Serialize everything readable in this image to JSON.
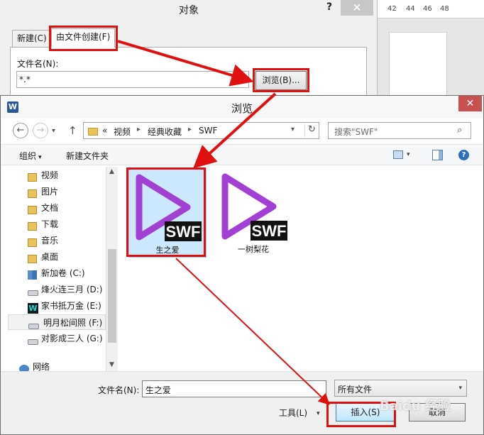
{
  "ruler": {
    "ticks": [
      "42",
      "44",
      "46",
      "48"
    ]
  },
  "object_dialog": {
    "title": "对象",
    "help": "?",
    "close": "✕",
    "tabs": [
      {
        "label": "新建(C)"
      },
      {
        "label": "由文件创建(F)"
      }
    ],
    "file_name_label": "文件名(N):",
    "file_name_value": "*.*",
    "browse_button": "浏览(B)..."
  },
  "browse_dialog": {
    "app_icon": "W",
    "title": "浏览",
    "close": "✕",
    "nav": {
      "back": "←",
      "forward": "→",
      "up": "↑",
      "dropdown": "▾"
    },
    "address": {
      "overflow": "«",
      "path": [
        "视频",
        "经典收藏",
        "SWF"
      ],
      "separator": "▸",
      "dropdown": "▾",
      "refresh": "↻"
    },
    "search": {
      "placeholder": "搜索\"SWF\"",
      "icon": "⌕"
    },
    "toolbar": {
      "organize": "组织",
      "organize_caret": "▾",
      "new_folder": "新建文件夹",
      "view_caret": "▾",
      "help": "?"
    },
    "nav_pane": {
      "items": [
        {
          "label": "视频",
          "icon": "library-icon"
        },
        {
          "label": "图片",
          "icon": "library-icon"
        },
        {
          "label": "文档",
          "icon": "library-icon"
        },
        {
          "label": "下载",
          "icon": "library-icon"
        },
        {
          "label": "音乐",
          "icon": "library-icon"
        },
        {
          "label": "桌面",
          "icon": "library-icon"
        },
        {
          "label": "新加卷 (C:)",
          "icon": "windows-drive-icon"
        },
        {
          "label": "烽火连三月 (D:)",
          "icon": "drive-icon"
        },
        {
          "label": "家书抵万金 (E:)",
          "icon": "w-drive-icon"
        },
        {
          "label": "明月松间照 (F:)",
          "icon": "drive-icon",
          "selected": true
        },
        {
          "label": "对影成三人 (G:)",
          "icon": "drive-icon"
        },
        {
          "label": "网络",
          "icon": "network-icon"
        }
      ],
      "scroll_up": "▲",
      "scroll_down": "▼"
    },
    "files": [
      {
        "name": "生之爱",
        "badge": "SWF",
        "selected": true
      },
      {
        "name": "一树梨花",
        "badge": "SWF",
        "selected": false
      }
    ],
    "bottom": {
      "file_name_label": "文件名(N):",
      "file_name_value": "生之爱",
      "file_type": "所有文件",
      "file_type_caret": "▾",
      "tools": "工具(L)",
      "tools_caret": "▾",
      "insert": "插入(S)",
      "cancel": "取消"
    }
  },
  "watermark": "Baidu 经验",
  "colors": {
    "highlight": "#e01010",
    "selection": "#cce8ff",
    "swf_icon": "#a23fd4",
    "close_red": "#c75050"
  }
}
